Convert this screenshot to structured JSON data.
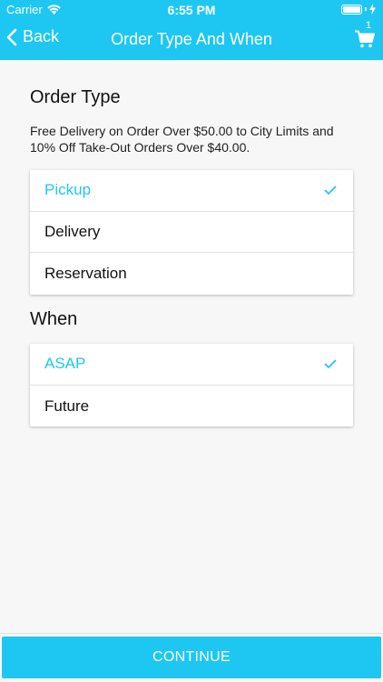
{
  "status_bar": {
    "carrier": "Carrier",
    "time": "6:55 PM"
  },
  "nav": {
    "back_label": "Back",
    "title": "Order Type And When",
    "cart_count": "1"
  },
  "order_type": {
    "title": "Order Type",
    "promo": "Free Delivery on Order Over $50.00 to City Limits and 10% Off Take-Out Orders Over $40.00.",
    "options": [
      {
        "label": "Pickup",
        "selected": true
      },
      {
        "label": "Delivery",
        "selected": false
      },
      {
        "label": "Reservation",
        "selected": false
      }
    ]
  },
  "when": {
    "title": "When",
    "options": [
      {
        "label": "ASAP",
        "selected": true
      },
      {
        "label": "Future",
        "selected": false
      }
    ]
  },
  "footer": {
    "continue_label": "CONTINUE"
  },
  "colors": {
    "accent": "#1ec7f2",
    "background": "#f7f7f7",
    "card": "#ffffff"
  }
}
